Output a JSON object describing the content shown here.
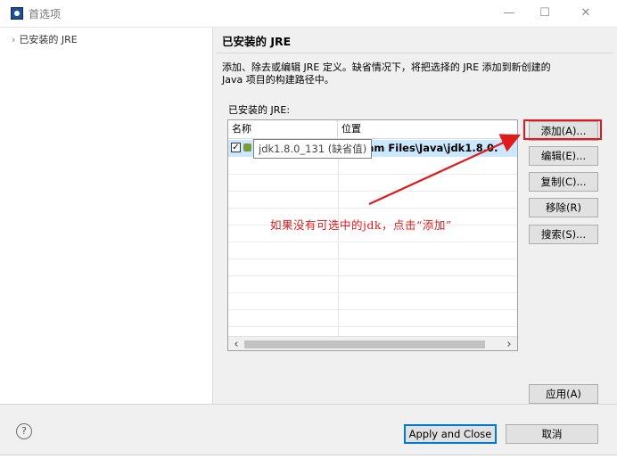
{
  "window": {
    "title": "首选项"
  },
  "tree": {
    "items": [
      {
        "label": "已安装的 JRE",
        "chevron": "›"
      }
    ]
  },
  "pane": {
    "title": "已安装的 JRE",
    "description_line1": "添加、除去或编辑 JRE 定义。缺省情况下，将把选择的 JRE 添加到新创建的",
    "description_line2": "Java 项目的构建路径中。",
    "installed_label": "已安装的 JRE:"
  },
  "table": {
    "columns": [
      "名称",
      "位置"
    ],
    "rows": [
      {
        "checked": true,
        "name": "jdk1.8.0_131 (缺省值)",
        "location": "ram Files\\Java\\jdk1.8.0."
      }
    ],
    "tooltip": "jdk1.8.0_131 (缺省值)"
  },
  "buttons": {
    "add": "添加(A)...",
    "edit": "编辑(E)...",
    "copy": "复制(C)...",
    "remove": "移除(R)",
    "search": "搜索(S)...",
    "apply": "应用(A)",
    "apply_and_close": "Apply and Close",
    "cancel": "取消"
  },
  "annotation": {
    "text": "如果没有可选中的jdk，点击“添加”",
    "color": "#e01b1b"
  },
  "icons": {
    "help": "?",
    "minimize": "—",
    "maximize": "☐",
    "close": "✕",
    "checkbox": "✓",
    "scroll_left": "‹",
    "scroll_right": "›"
  },
  "colors": {
    "accent": "#0078d7",
    "highlight": "#e8151b",
    "selection": "#cce8ff"
  }
}
